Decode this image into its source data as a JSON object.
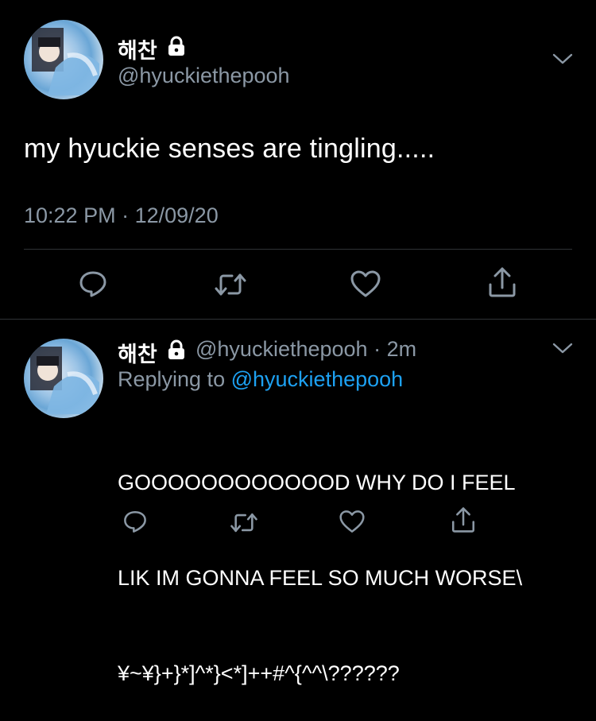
{
  "main_tweet": {
    "display_name": "해찬",
    "handle": "@hyuckiethepooh",
    "text": "my hyuckie senses are tingling.....",
    "time": "10:22 PM",
    "date": "12/09/20",
    "separator": "·"
  },
  "reply": {
    "display_name": "해찬",
    "handle": "@hyuckiethepooh",
    "relative_time": "· 2m",
    "replying_to_prefix": "Replying to",
    "replying_to_handle": "@hyuckiethepooh",
    "lines": [
      "GOOOOOOOOOOOOD WHY DO I FEEL",
      "LIK IM GONNA FEEL SO MUCH WORSE\\",
      "¥~¥}+}*]^*}<*]++#^{^^\\??????"
    ]
  },
  "icons": {
    "lock": "lock-icon",
    "chevron": "chevron-down-icon",
    "reply": "reply-icon",
    "retweet": "retweet-icon",
    "like": "heart-icon",
    "share": "share-icon"
  },
  "colors": {
    "background": "#000000",
    "text": "#ffffff",
    "secondary": "#8b98a5",
    "link": "#1da1f2",
    "divider": "#2f3336"
  }
}
